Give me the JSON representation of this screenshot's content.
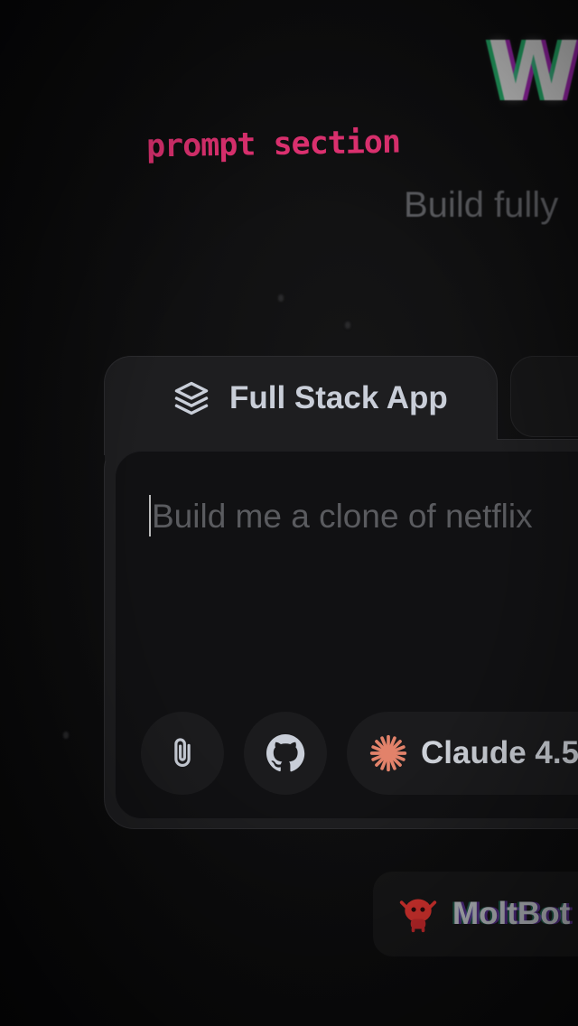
{
  "annotation": {
    "text": "prompt section"
  },
  "hero": {
    "title_fragment": "W",
    "subtitle_fragment": "Build fully"
  },
  "tabs": [
    {
      "label": "Full Stack App",
      "icon": "stack-layers-icon",
      "active": true
    }
  ],
  "prompt": {
    "value": "",
    "placeholder": "Build me a clone of netflix"
  },
  "toolbar": {
    "attach_icon": "paperclip-icon",
    "github_icon": "github-icon",
    "model": {
      "label": "Claude 4.5",
      "icon": "sparkle-icon",
      "icon_color": "#e2826a"
    }
  },
  "suggestions": [
    {
      "label": "MoltBot",
      "icon": "red-robot-icon",
      "icon_color": "#d9332f"
    }
  ],
  "colors": {
    "annotation": "#f2357a",
    "background": "#0d0d0e",
    "card": "#1e1e20",
    "input_area": "#111113"
  }
}
